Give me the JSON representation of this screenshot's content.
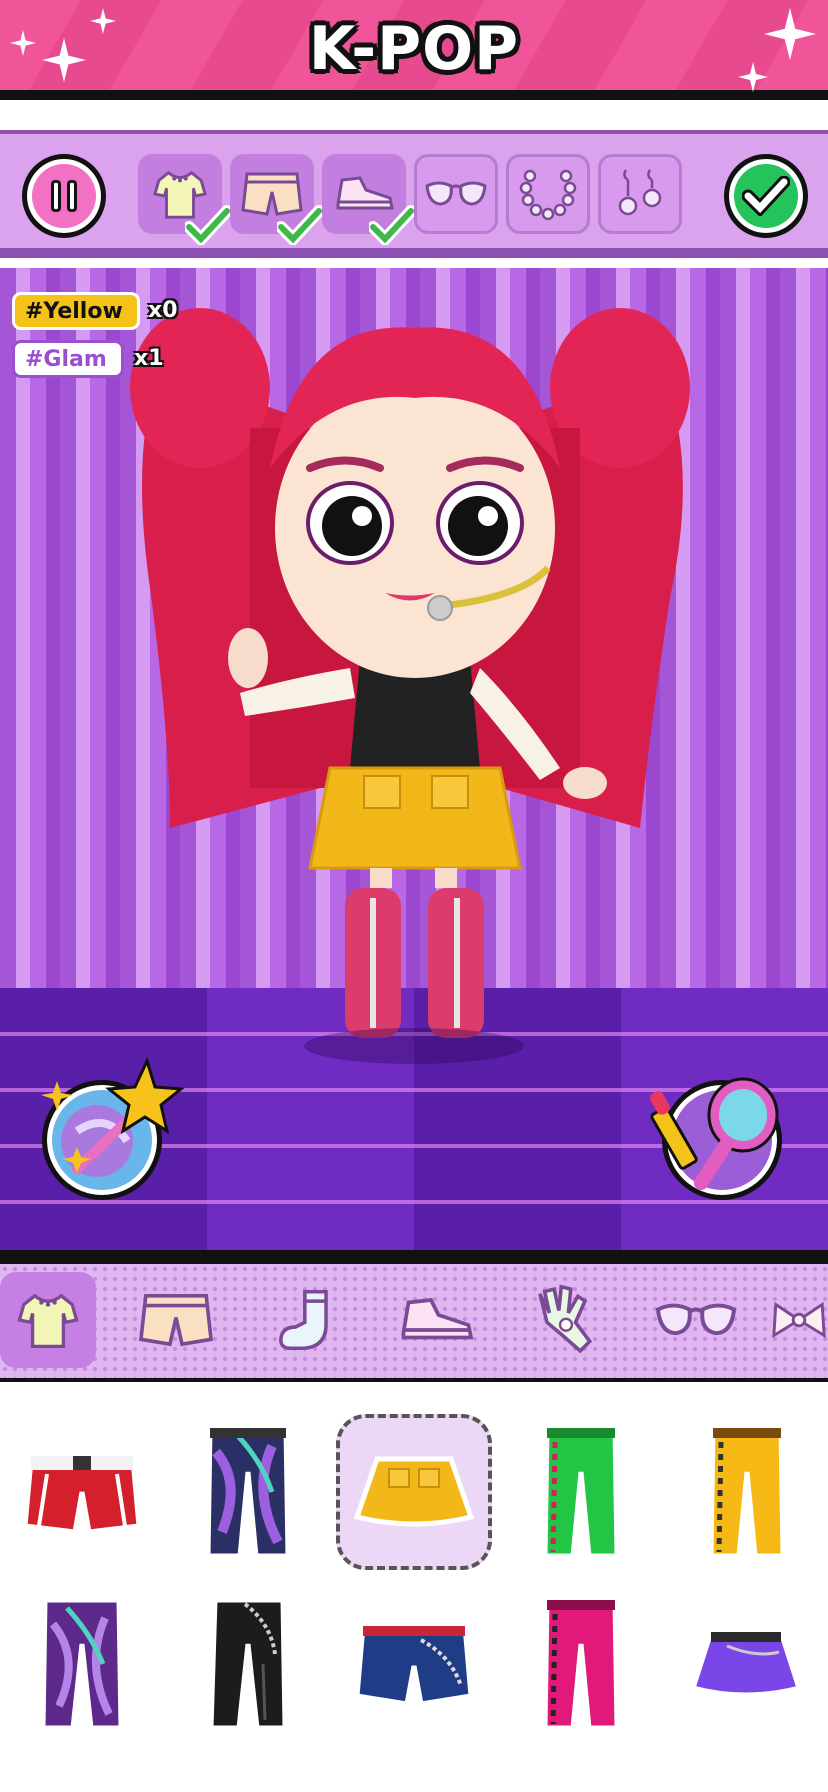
{
  "header": {
    "title": "K-POP",
    "color": "#f0559a"
  },
  "toolbar": {
    "pause_icon": "pause-icon",
    "confirm_icon": "check-icon",
    "slots": [
      {
        "icon": "top-icon",
        "completed": true
      },
      {
        "icon": "shorts-icon",
        "completed": true
      },
      {
        "icon": "sneaker-icon",
        "completed": true
      },
      {
        "icon": "glasses-icon",
        "completed": false
      },
      {
        "icon": "necklace-icon",
        "completed": false
      },
      {
        "icon": "earrings-icon",
        "completed": false
      }
    ]
  },
  "tags": [
    {
      "label": "#Yellow",
      "count": "x0",
      "color": "#f5c21a"
    },
    {
      "label": "#Glam",
      "count": "x1",
      "color": "#9a4fd0"
    }
  ],
  "stage": {
    "magic_button_icon": "magic-wand-icon",
    "makeup_button_icon": "mirror-lipstick-icon"
  },
  "categories": [
    {
      "icon": "top-icon",
      "active": true
    },
    {
      "icon": "shorts-icon",
      "active": false
    },
    {
      "icon": "sock-icon",
      "active": false
    },
    {
      "icon": "sneaker-icon",
      "active": false
    },
    {
      "icon": "glove-icon",
      "active": false
    },
    {
      "icon": "glasses-icon",
      "active": false
    },
    {
      "icon": "bow-icon",
      "active": false
    }
  ],
  "items": [
    {
      "icon": "red-shorts-icon",
      "selected": false
    },
    {
      "icon": "purple-chain-pants-icon",
      "selected": false
    },
    {
      "icon": "yellow-skirt-icon",
      "selected": true
    },
    {
      "icon": "green-pants-icon",
      "selected": false
    },
    {
      "icon": "yellow-pants-icon",
      "selected": false
    },
    {
      "icon": "purple-pants-icon",
      "selected": false
    },
    {
      "icon": "black-pants-icon",
      "selected": false
    },
    {
      "icon": "denim-shorts-icon",
      "selected": false
    },
    {
      "icon": "pink-pants-icon",
      "selected": false
    },
    {
      "icon": "purple-skirt-icon",
      "selected": false
    }
  ]
}
